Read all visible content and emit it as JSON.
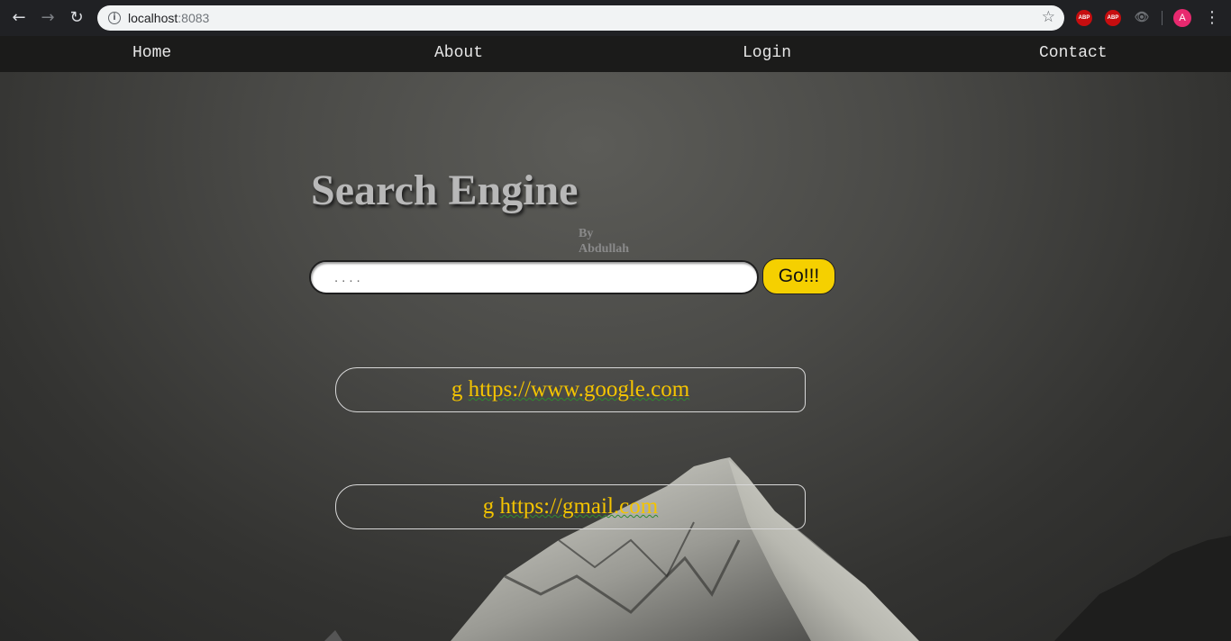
{
  "browser": {
    "url_host": "localhost",
    "url_port": ":8083",
    "avatar_letter": "A",
    "ext_abp_label": "ABP",
    "ext_abp2_label": "ABP"
  },
  "nav": {
    "items": [
      {
        "label": "Home"
      },
      {
        "label": "About"
      },
      {
        "label": "Login"
      },
      {
        "label": "Contact"
      }
    ]
  },
  "hero": {
    "title": "Search Engine",
    "byline_1": "By",
    "byline_2": "Abdullah"
  },
  "search": {
    "placeholder": "....",
    "button_label": "Go!!!"
  },
  "results": [
    {
      "prefix": "g",
      "link": "https://www.google.com"
    },
    {
      "prefix": "g",
      "link": "https://gmail.com"
    }
  ],
  "colors": {
    "accent": "#f5d000",
    "link_text": "#f4c400"
  }
}
